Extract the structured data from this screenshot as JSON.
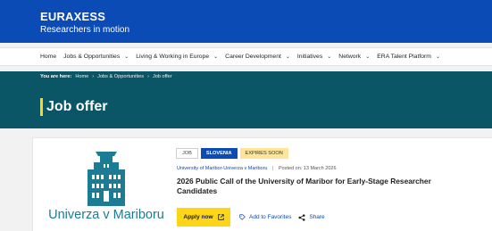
{
  "header": {
    "brand": "EURAXESS",
    "tagline": "Researchers in motion"
  },
  "nav": {
    "items": [
      {
        "label": "Home",
        "dropdown": false
      },
      {
        "label": "Jobs & Opportunities",
        "dropdown": true
      },
      {
        "label": "Living & Working in Europe",
        "dropdown": true
      },
      {
        "label": "Career Development",
        "dropdown": true
      },
      {
        "label": "Initiatives",
        "dropdown": true
      },
      {
        "label": "Network",
        "dropdown": true
      },
      {
        "label": "ERA Talent Platform",
        "dropdown": true
      }
    ],
    "chevron": "⌄"
  },
  "breadcrumb": {
    "prefix": "You are here:",
    "items": [
      "Home",
      "Jobs & Opportunities",
      "Job offer"
    ],
    "separator": "›"
  },
  "hero": {
    "title": "Job offer"
  },
  "job": {
    "logo_text": "Univerza v Mariboru",
    "badges": {
      "type": "JOB",
      "country": "SLOVENIA",
      "status": "EXPIRES SOON"
    },
    "organisation": "University of Maribor-Univerza v Mariboru",
    "separator": "|",
    "posted": "Posted on: 13 March 2026",
    "title": "2026 Public Call of the University of Maribor for Early-Stage Researcher Candidates",
    "apply_label": "Apply now",
    "favorites_label": "Add to Favorites",
    "share_label": "Share"
  },
  "colors": {
    "brand_blue": "#0b4bb5",
    "hero_teal": "#0a5566",
    "accent_yellow": "#ffd617",
    "expires_badge": "#ffe599",
    "logo_teal": "#1b7c94"
  }
}
